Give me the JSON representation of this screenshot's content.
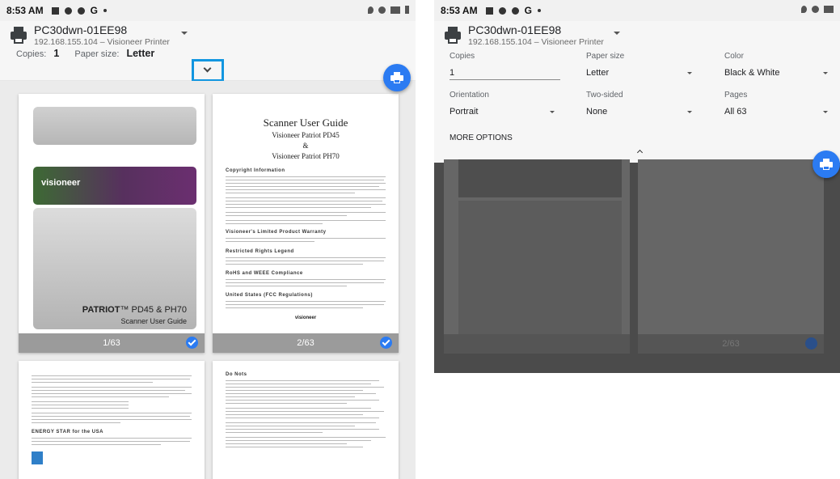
{
  "left": {
    "status_bar": {
      "time": "8:53 AM",
      "glyph": "G"
    },
    "printer": {
      "name": "PC30dwn-01EE98",
      "address": "192.168.155.104 – Visioneer Printer"
    },
    "summary": {
      "copies_label": "Copies:",
      "copies_value": "1",
      "paper_label": "Paper size:",
      "paper_value": "Letter"
    },
    "pages": [
      {
        "label": "1/63",
        "cover": {
          "logo": "visioneer",
          "brand_bold": "PATRIOT",
          "brand_rest": "™ PD45 & PH70",
          "subtitle": "Scanner User Guide"
        }
      },
      {
        "label": "2/63",
        "guide": {
          "title": "Scanner User Guide",
          "line2": "Visioneer Patriot PD45",
          "amp": "&",
          "line3": "Visioneer Patriot PH70",
          "headings": [
            "Copyright Information",
            "Visioneer's Limited Product Warranty",
            "Restricted Rights Legend",
            "RoHS and WEEE Compliance",
            "United States (FCC Regulations)"
          ],
          "footer": "visioneer"
        }
      }
    ],
    "page_lower_left": {
      "heading": "ENERGY STAR for the USA"
    },
    "page_lower_right": {
      "heading": "Do Nots"
    }
  },
  "right": {
    "status_bar": {
      "time": "8:53 AM",
      "glyph": "G"
    },
    "printer": {
      "name": "PC30dwn-01EE98",
      "address": "192.168.155.104 – Visioneer Printer"
    },
    "options": {
      "copies": {
        "label": "Copies",
        "value": "1"
      },
      "paper_size": {
        "label": "Paper size",
        "value": "Letter"
      },
      "color": {
        "label": "Color",
        "value": "Black & White"
      },
      "orientation": {
        "label": "Orientation",
        "value": "Portrait"
      },
      "two_sided": {
        "label": "Two-sided",
        "value": "None"
      },
      "pages": {
        "label": "Pages",
        "value": "All 63"
      }
    },
    "more_options": "MORE OPTIONS",
    "page_label": "2/63"
  },
  "colors": {
    "accent": "#2b7bf2",
    "highlight_border": "#1296e0",
    "page_bar": "#9b9b9b"
  },
  "icons": [
    "printer-icon",
    "chevron-down-icon",
    "chevron-up-icon",
    "print-fab-icon",
    "check-icon"
  ]
}
